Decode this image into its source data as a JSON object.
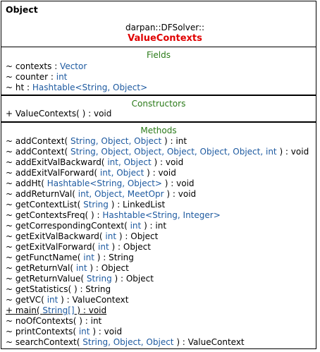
{
  "diagram": {
    "kind_label": "Object",
    "namespace": "darpan::DFSolver::",
    "class_name": "ValueContexts",
    "colors": {
      "class_name": "#e00000",
      "section_title": "#2a7a18",
      "type": "#1e5aa0"
    }
  },
  "fields": {
    "title": "Fields",
    "items": [
      {
        "vis": "~",
        "name": "contexts",
        "sep": " : ",
        "type": "Vector",
        "rest": ""
      },
      {
        "vis": "~",
        "name": "counter",
        "sep": " : ",
        "type": "int",
        "rest": ""
      },
      {
        "vis": "~",
        "name": "ht",
        "sep": " : ",
        "type": "Hashtable<String, Object>",
        "rest": ""
      }
    ]
  },
  "constructors": {
    "title": "Constructors",
    "items": [
      {
        "vis": "+",
        "name": "ValueContexts( )",
        "sep": " : ",
        "type": "",
        "rest": "void"
      }
    ]
  },
  "methods": {
    "title": "Methods",
    "items": [
      {
        "vis": "~",
        "name": "addContext( ",
        "sep": "",
        "type": "String, Object, Object",
        "rest": " ) : int"
      },
      {
        "vis": "~",
        "name": "addContext( ",
        "sep": "",
        "type": "String, Object, Object, Object, Object, Object, int",
        "rest": " ) : void"
      },
      {
        "vis": "~",
        "name": "addExitValBackward( ",
        "sep": "",
        "type": "int, Object",
        "rest": " ) : void"
      },
      {
        "vis": "~",
        "name": "addExitValForward( ",
        "sep": "",
        "type": "int, Object",
        "rest": " ) : void"
      },
      {
        "vis": "~",
        "name": "addHt( ",
        "sep": "",
        "type": "Hashtable<String, Object>",
        "rest": " ) : void"
      },
      {
        "vis": "~",
        "name": "addReturnVal( ",
        "sep": "",
        "type": "int, Object, MeetOpr",
        "rest": " ) : void"
      },
      {
        "vis": "~",
        "name": "getContextList( ",
        "sep": "",
        "type": "String",
        "rest": " ) : LinkedList"
      },
      {
        "vis": "~",
        "name": "getContextsFreq( ) : ",
        "sep": "",
        "type": "Hashtable<String, Integer>",
        "rest": ""
      },
      {
        "vis": "~",
        "name": "getCorrespondingContext( ",
        "sep": "",
        "type": "int",
        "rest": " ) : int"
      },
      {
        "vis": "~",
        "name": "getExitValBackward( ",
        "sep": "",
        "type": "int",
        "rest": " ) : Object"
      },
      {
        "vis": "~",
        "name": "getExitValForward( ",
        "sep": "",
        "type": "int",
        "rest": " ) : Object"
      },
      {
        "vis": "~",
        "name": "getFunctName( ",
        "sep": "",
        "type": "int",
        "rest": " ) : String"
      },
      {
        "vis": "~",
        "name": "getReturnVal( ",
        "sep": "",
        "type": "int",
        "rest": " ) : Object"
      },
      {
        "vis": "~",
        "name": "getReturnValue( ",
        "sep": "",
        "type": "String",
        "rest": " ) : Object"
      },
      {
        "vis": "~",
        "name": "getStatistics( ) : String",
        "sep": "",
        "type": "",
        "rest": ""
      },
      {
        "vis": "~",
        "name": "getVC( ",
        "sep": "",
        "type": "int",
        "rest": " ) : ValueContext"
      },
      {
        "vis": "+",
        "name": "main( ",
        "sep": "",
        "type": "String[]",
        "rest": " ) : void",
        "static": true
      },
      {
        "vis": "~",
        "name": "noOfContexts( ) : int",
        "sep": "",
        "type": "",
        "rest": ""
      },
      {
        "vis": "~",
        "name": "printContexts( ",
        "sep": "",
        "type": "int",
        "rest": " ) : void"
      },
      {
        "vis": "~",
        "name": "searchContext( ",
        "sep": "",
        "type": "String, Object, Object",
        "rest": " ) : ValueContext"
      }
    ]
  }
}
